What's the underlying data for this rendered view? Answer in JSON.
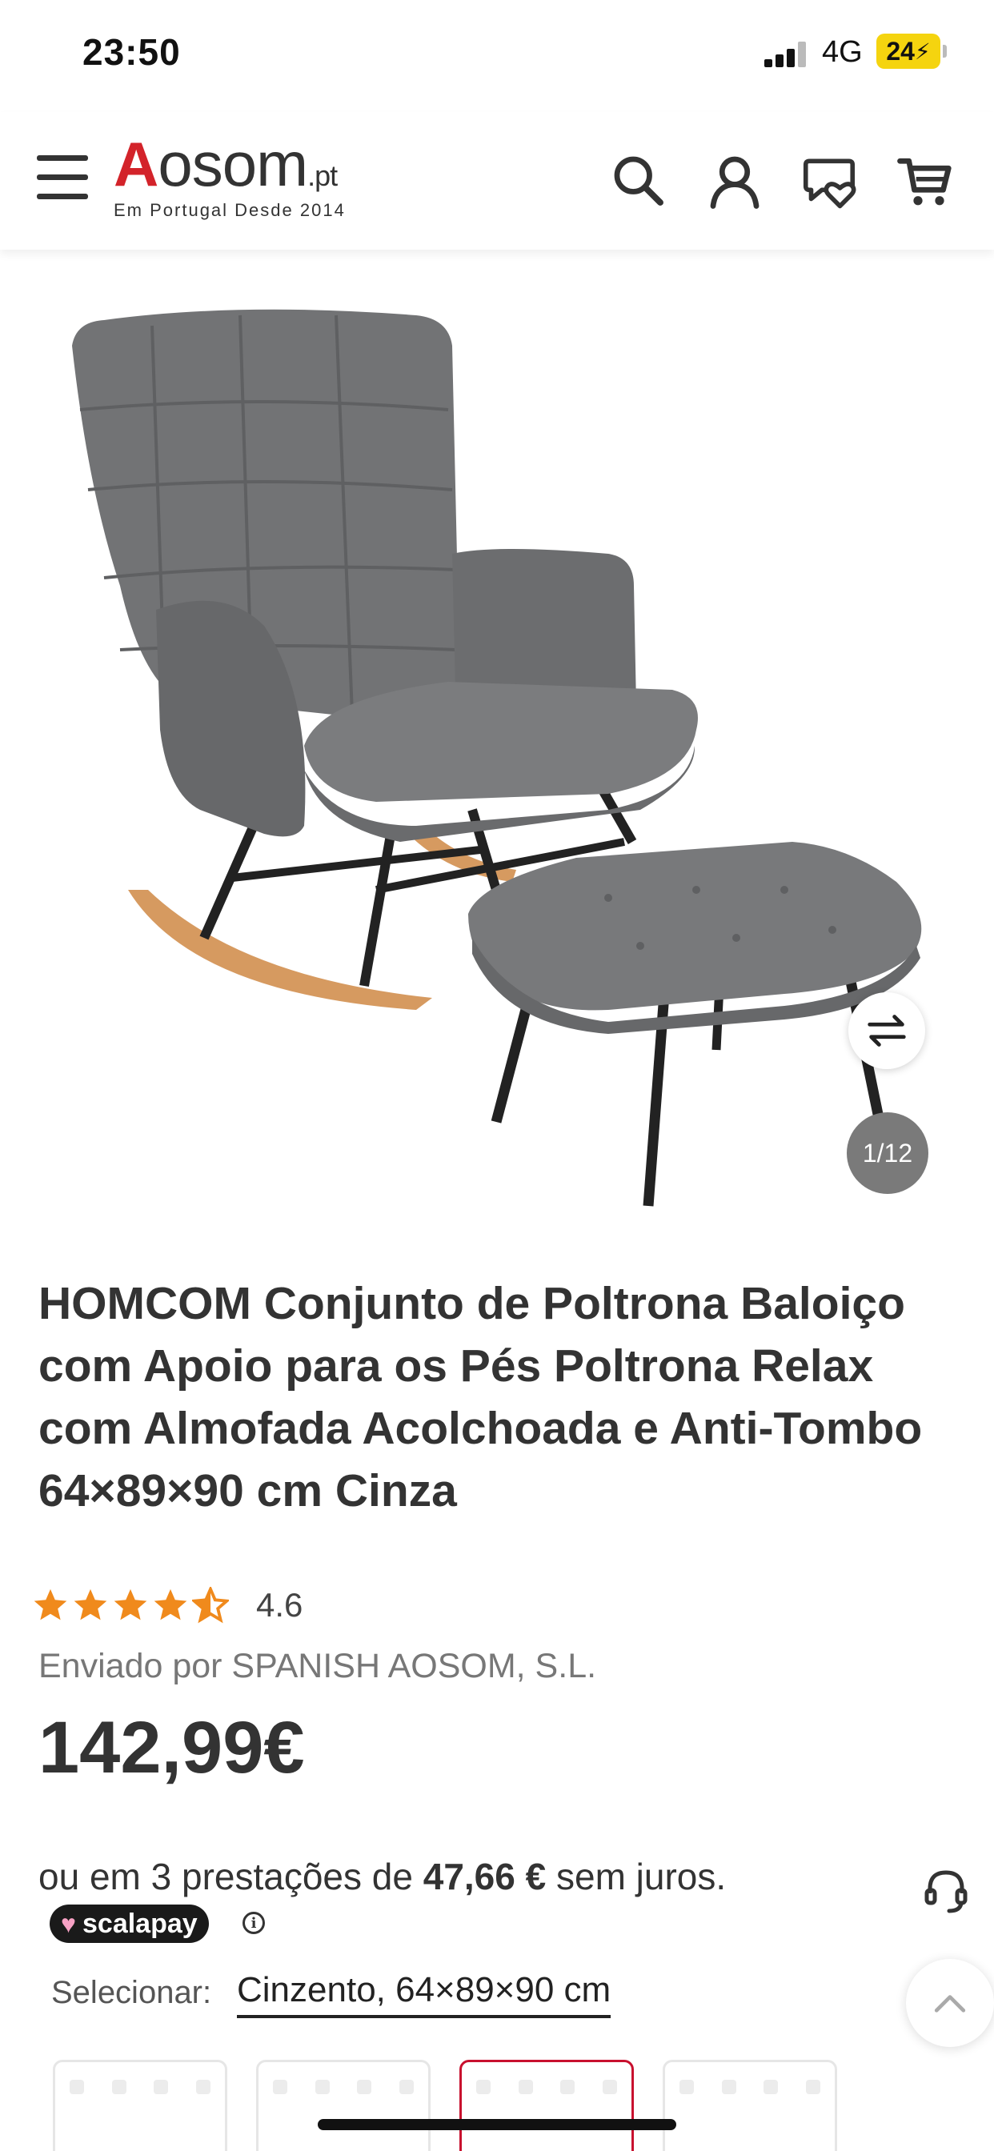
{
  "status_bar": {
    "time": "23:50",
    "network": "4G",
    "battery": "24"
  },
  "header": {
    "logo_letter": "A",
    "logo_text": "osom",
    "logo_tld": ".pt",
    "logo_tagline": "Em Portugal Desde 2014",
    "icons": [
      "menu-icon",
      "search-icon",
      "user-icon",
      "wishlist-icon",
      "cart-icon"
    ]
  },
  "gallery": {
    "counter": "1/12",
    "swap_icon": "swap-arrows-icon"
  },
  "product": {
    "title": "HOMCOM Conjunto de Poltrona Baloiço com Apoio para os Pés Poltrona Relax com Almofada Acolchoada e Anti-Tombo 64×89×90 cm Cinza",
    "rating": "4.6",
    "rating_value": 4.6,
    "rating_max": 5,
    "seller": "Enviado por SPANISH AOSOM, S.L.",
    "price": "142,99€",
    "installments_prefix": "ou em 3 prestações de ",
    "installments_amount": "47,66 €",
    "installments_suffix": " sem juros.",
    "scalapay_label": "scalapay",
    "select_label": "Selecionar:",
    "select_value": "Cinzento, 64×89×90 cm"
  },
  "colors": {
    "brand_red": "#d3232a",
    "star_orange": "#f08a1c",
    "selected_border": "#c8102e"
  }
}
